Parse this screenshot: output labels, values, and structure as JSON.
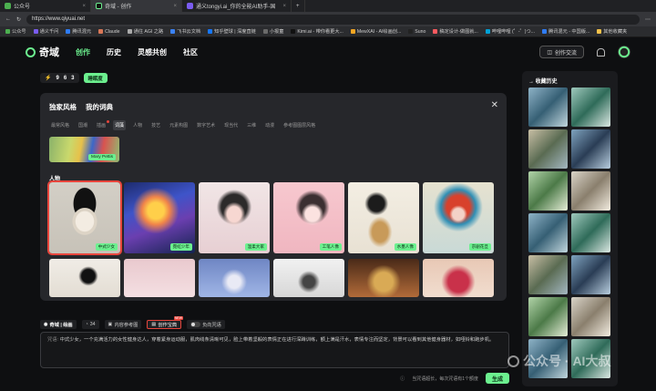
{
  "browser": {
    "tabs": [
      {
        "title": "公众号",
        "active": false
      },
      {
        "title": "奇域 - 创作",
        "active": true
      },
      {
        "title": "通义tongyi.ai_你的全能AI助手-国",
        "active": false
      }
    ],
    "url": "https://www.qiyuai.net",
    "bookmarks": [
      "公众号",
      "通义千问",
      "腾讯混元",
      "Claude",
      "通往 AGI 之路",
      "飞书云文档",
      "知乎壁球 | 深度直链",
      "小报童",
      "Kimi.ai - 带你看更大...",
      "MewXAI - AI绘画创...",
      "Suno",
      "稿定设计-做图就...",
      "哔哩哔哩 (゜-゜)つ...",
      "腾讯混元 - 中国版...",
      "其他收藏夹"
    ]
  },
  "site": {
    "logo": "奇域",
    "nav": [
      "创作",
      "历史",
      "灵感共创",
      "社区"
    ],
    "nav_active": "创作",
    "creation_exchange": "创作交流"
  },
  "toolrow": {
    "counter": [
      "9",
      "6",
      "3"
    ],
    "badge": "睡眠度"
  },
  "style_panel": {
    "tabs": [
      "独家风格",
      "我的词典"
    ],
    "categories": [
      "最常风格",
      "国潮",
      "插画",
      "词藻",
      "人物",
      "技艺",
      "元素构图",
      "数字艺术",
      "现当代",
      "三维",
      "动漫",
      "参考图图层风格"
    ],
    "active_category": "词藻",
    "dot_category": "插画",
    "recent": "Mary Pettis",
    "section": "人物",
    "cards_row1": [
      {
        "tag": "中式少女",
        "selected": true
      },
      {
        "tag": "霓虹少年",
        "selected": false
      },
      {
        "tag": "温柔大家",
        "selected": false
      },
      {
        "tag": "工笔人像",
        "selected": false
      },
      {
        "tag": "水墨人像",
        "selected": false
      },
      {
        "tag": "京剧花旦",
        "selected": false
      }
    ]
  },
  "options": {
    "model": "奇域 | 绘画",
    "count": "34",
    "paint_ref": "内容参考图",
    "creative_treasure": "创作宝典",
    "negative": "负向咒语"
  },
  "prompt": {
    "label": "咒语:",
    "text": "中式少女，一个充满活力的女性健身达人，穿着紧身运动服，肌肉线条清晰可见，脸上带着坚毅的表情正在进行深蹲训练，额上满是汗水，表情专注而坚定，背景可以看到其他健身器材，如哑铃和跑步机。"
  },
  "bottom": {
    "hint": "当咒语超长，每次咒语有1个额度",
    "generate": "生成"
  },
  "history": {
    "title": "收藏历史"
  },
  "watermark": "公众号 · AI大叔"
}
